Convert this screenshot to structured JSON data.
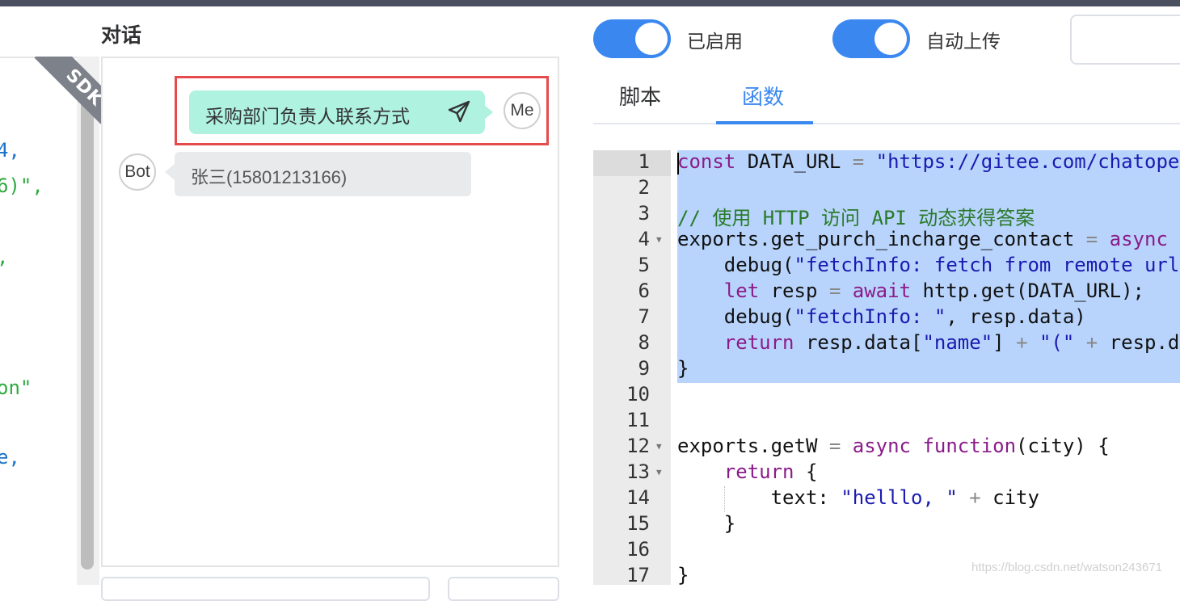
{
  "left_code_fragments": [
    {
      "text": "4,",
      "color": "blue"
    },
    {
      "text": "6)\",",
      "color": "green"
    },
    {
      "text": ",",
      "color": "green"
    },
    {
      "text": "on\"",
      "color": "green"
    },
    {
      "text": "e,",
      "color": "blue"
    }
  ],
  "sdk_badge": "SDK",
  "chat": {
    "title": "对话",
    "user_message": "采购部门负责人联系方式",
    "user_avatar": "Me",
    "bot_avatar": "Bot",
    "bot_message": "张三(15801213166)"
  },
  "toggles": [
    {
      "label": "已启用",
      "on": true
    },
    {
      "label": "自动上传",
      "on": true
    }
  ],
  "tabs": [
    {
      "label": "脚本",
      "active": false
    },
    {
      "label": "函数",
      "active": true
    }
  ],
  "editor": {
    "line_numbers": [
      "1",
      "2",
      "3",
      "4",
      "5",
      "6",
      "7",
      "8",
      "9",
      "10",
      "11",
      "12",
      "13",
      "14",
      "15",
      "16",
      "17"
    ],
    "lines": [
      "const DATA_URL = \"https://gitee.com/chatope",
      "",
      "// 使用 HTTP 访问 API 动态获得答案",
      "exports.get_purch_incharge_contact = async",
      "    debug(\"fetchInfo: fetch from remote url",
      "    let resp = await http.get(DATA_URL);",
      "    debug(\"fetchInfo: \", resp.data)",
      "    return resp.data[\"name\"] + \"(\" + resp.da",
      "}",
      "",
      "",
      "exports.getW = async function(city) {",
      "    return {",
      "        text: \"helllo, \" + city",
      "    }",
      "",
      "}"
    ],
    "selected_lines": [
      1,
      9
    ]
  },
  "watermark": "https://blog.csdn.net/watson243671",
  "colors": {
    "accent": "#3a87f0",
    "user_bubble": "#aff2e0",
    "highlight_border": "#e54b4b",
    "selection": "#b8d4fc"
  }
}
